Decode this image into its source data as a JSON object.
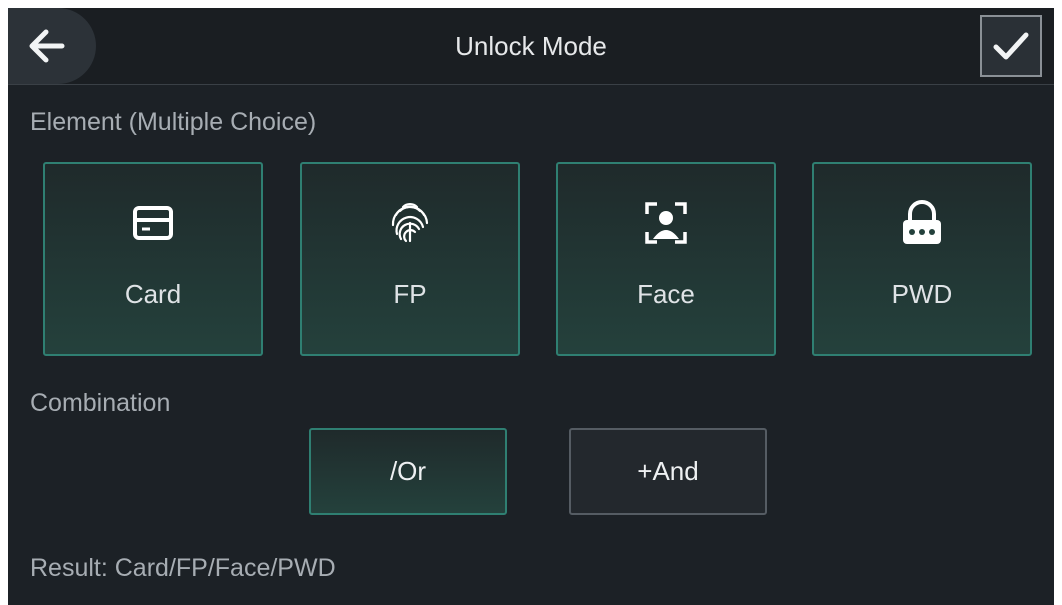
{
  "header": {
    "title": "Unlock Mode",
    "back_icon": "arrow-left-icon",
    "confirm_icon": "checkmark-icon"
  },
  "element_section": {
    "label": "Element (Multiple Choice)",
    "items": [
      {
        "label": "Card",
        "icon": "card-icon",
        "selected": true
      },
      {
        "label": "FP",
        "icon": "fingerprint-icon",
        "selected": true
      },
      {
        "label": "Face",
        "icon": "face-icon",
        "selected": true
      },
      {
        "label": "PWD",
        "icon": "password-lock-icon",
        "selected": true
      }
    ]
  },
  "combination_section": {
    "label": "Combination",
    "or_label": "/Or",
    "and_label": "+And",
    "selected": "or"
  },
  "result": {
    "text": "Result: Card/FP/Face/PWD"
  },
  "colors": {
    "background": "#1c2126",
    "selected_border": "#2f7f72",
    "text": "#dfe3e6",
    "muted_text": "#a7adb3"
  }
}
